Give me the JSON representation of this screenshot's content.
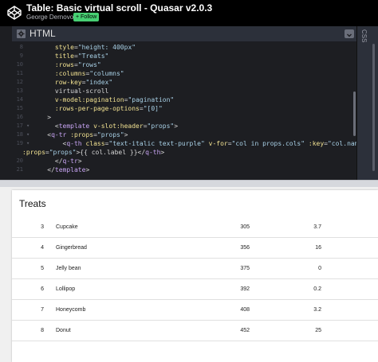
{
  "header": {
    "title": "Table: Basic virtual scroll - Quasar v2.0.3",
    "author": "George Dernovoy",
    "follow_label": "+ Follow"
  },
  "editor": {
    "language": "HTML",
    "side_panel_label": "CSS",
    "lines": [
      {
        "num": "8",
        "fold": "",
        "text": "      style=\"height: 400px\""
      },
      {
        "num": "9",
        "fold": "",
        "text": "      title=\"Treats\""
      },
      {
        "num": "10",
        "fold": "",
        "text": "      :rows=\"rows\""
      },
      {
        "num": "11",
        "fold": "",
        "text": "      :columns=\"columns\""
      },
      {
        "num": "12",
        "fold": "",
        "text": "      row-key=\"index\""
      },
      {
        "num": "13",
        "fold": "",
        "text": "      virtual-scroll"
      },
      {
        "num": "14",
        "fold": "",
        "text": "      v-model:pagination=\"pagination\""
      },
      {
        "num": "15",
        "fold": "",
        "text": "      :rows-per-page-options=\"[0]\""
      },
      {
        "num": "16",
        "fold": "",
        "text": "    >"
      },
      {
        "num": "17",
        "fold": "▾",
        "text": "      <template v-slot:header=\"props\">"
      },
      {
        "num": "18",
        "fold": "▾",
        "text": "    <q-tr :props=\"props\">"
      },
      {
        "num": "19",
        "fold": "▾",
        "text": "        <q-th class=\"text-italic text-purple\" v-for=\"col in props.cols\" :key=\"col.name\""
      },
      {
        "num": "",
        "fold": "",
        "text": ":props=\"props\">{{ col.label }}</q-th>"
      },
      {
        "num": "20",
        "fold": "",
        "text": "      </q-tr>"
      },
      {
        "num": "21",
        "fold": "",
        "text": "    </template>"
      }
    ]
  },
  "result": {
    "table_title": "Treats",
    "rows": [
      {
        "index": "3",
        "name": "Cupcake",
        "calories": "305",
        "fat": "3.7"
      },
      {
        "index": "4",
        "name": "Gingerbread",
        "calories": "356",
        "fat": "16"
      },
      {
        "index": "5",
        "name": "Jelly bean",
        "calories": "375",
        "fat": "0"
      },
      {
        "index": "6",
        "name": "Lollipop",
        "calories": "392",
        "fat": "0.2"
      },
      {
        "index": "7",
        "name": "Honeycomb",
        "calories": "408",
        "fat": "3.2"
      },
      {
        "index": "8",
        "name": "Donut",
        "calories": "452",
        "fat": "25"
      }
    ]
  },
  "colors": {
    "follow_green": "#47cf73",
    "editor_bg": "#1d1e22",
    "attr_yellow": "#f1e191",
    "string_blue": "#a8d0e6",
    "tag_purple": "#c7a4f3"
  }
}
